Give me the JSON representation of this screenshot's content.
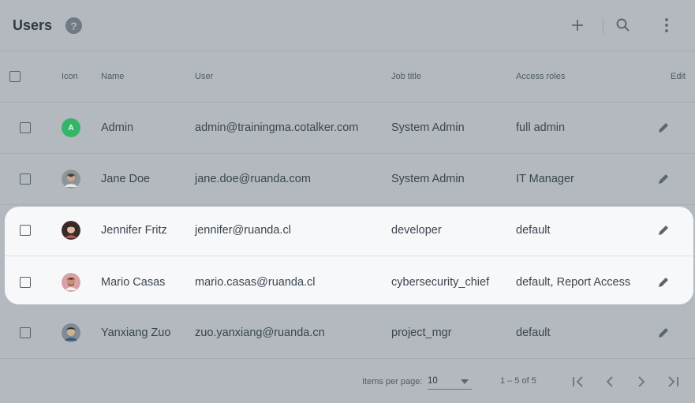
{
  "toolbar": {
    "title": "Users",
    "help_glyph": "?",
    "add_icon": "plus-icon",
    "search_icon": "search-icon",
    "menu_icon": "more-vert-icon"
  },
  "table": {
    "headers": {
      "icon": "Icon",
      "name": "Name",
      "user": "User",
      "job_title": "Job title",
      "access_roles": "Access roles",
      "edit": "Edit"
    },
    "rows": [
      {
        "avatar_letter": "A",
        "name": "Admin",
        "user": "admin@trainingma.cotalker.com",
        "job_title": "System Admin",
        "access_roles": "full admin"
      },
      {
        "name": "Jane Doe",
        "user": "jane.doe@ruanda.com",
        "job_title": "System Admin",
        "access_roles": "IT Manager"
      },
      {
        "name": "Jennifer Fritz",
        "user": "jennifer@ruanda.cl",
        "job_title": "developer",
        "access_roles": "default"
      },
      {
        "name": "Mario Casas",
        "user": "mario.casas@ruanda.cl",
        "job_title": "cybersecurity_chief",
        "access_roles": "default, Report Access"
      },
      {
        "name": "Yanxiang Zuo",
        "user": "zuo.yanxiang@ruanda.cn",
        "job_title": "project_mgr",
        "access_roles": "default"
      }
    ]
  },
  "paginator": {
    "items_per_page_label": "Items per page:",
    "items_per_page_value": "10",
    "range_label": "1 – 5 of 5"
  },
  "colors": {
    "accent_avatar": "#34b56a",
    "highlight": "#f6f8fa",
    "overlay": "#b3b9be"
  }
}
